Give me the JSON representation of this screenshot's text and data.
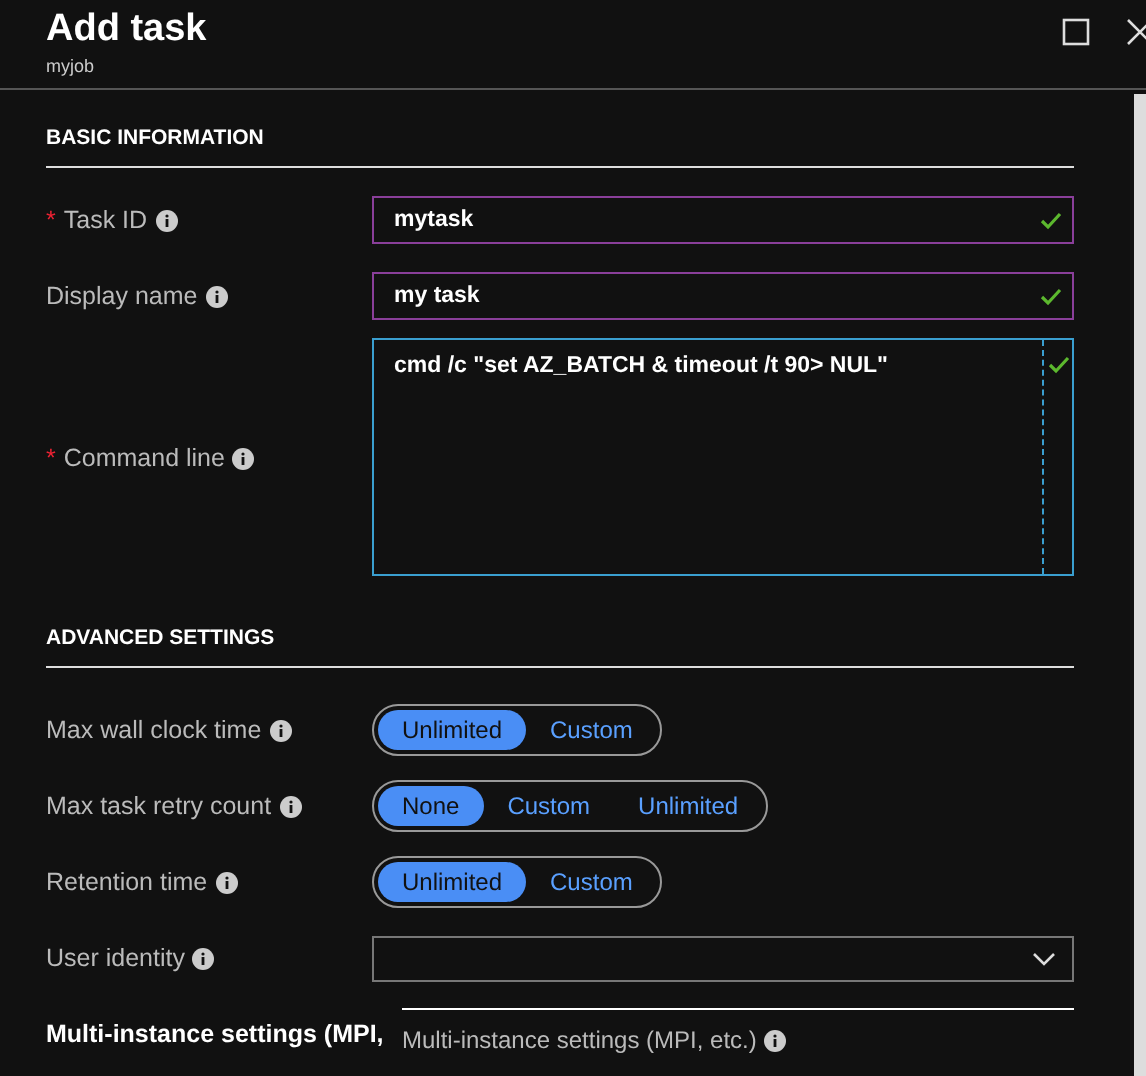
{
  "window": {
    "title": "Add task",
    "subtitle": "myjob"
  },
  "sections": [
    {
      "title": "BASIC INFORMATION",
      "fields": [
        {
          "kind": "text",
          "required_mark": "*",
          "label": "Task ID",
          "value": "mytask",
          "valid": true
        },
        {
          "kind": "text",
          "label": "Display name",
          "value": "my task",
          "valid": true
        },
        {
          "kind": "textarea",
          "required_mark": "*",
          "label": "Command line",
          "value": "cmd /c \"set AZ_BATCH & timeout /t 90> NUL\"",
          "valid": true
        }
      ]
    },
    {
      "title": "ADVANCED SETTINGS",
      "fields": [
        {
          "kind": "segmented",
          "label": "Max wall clock time",
          "options": [
            {
              "label": "Unlimited",
              "selected": true
            },
            {
              "label": "Custom",
              "selected": false
            }
          ]
        },
        {
          "kind": "segmented",
          "label": "Max task retry count",
          "options": [
            {
              "label": "None",
              "selected": true
            },
            {
              "label": "Custom",
              "selected": false
            },
            {
              "label": "Unlimited",
              "selected": false
            }
          ]
        },
        {
          "kind": "segmented",
          "label": "Retention time",
          "options": [
            {
              "label": "Unlimited",
              "selected": true
            },
            {
              "label": "Custom",
              "selected": false
            }
          ]
        },
        {
          "kind": "dropdown",
          "label": "User identity"
        }
      ]
    }
  ],
  "multi_instance": {
    "heading": "Multi-instance settings (MPI,",
    "link": "Multi-instance settings (MPI, etc.)"
  }
}
